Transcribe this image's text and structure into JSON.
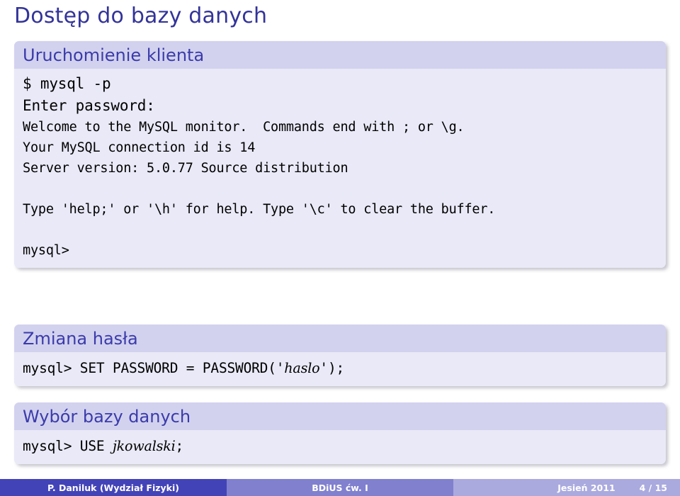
{
  "slide": {
    "title": "Dostęp do bazy danych",
    "blocks": [
      {
        "id": "client",
        "title": "Uruchomienie klienta",
        "lines": [
          "$ mysql -p",
          "Enter password:",
          "Welcome to the MySQL monitor.  Commands end with ; or \\g.",
          "Your MySQL connection id is 14",
          "Server version: 5.0.77 Source distribution",
          "",
          "Type 'help;' or '\\h' for help. Type '\\c' to clear the buffer.",
          "",
          "mysql>"
        ]
      },
      {
        "id": "password",
        "title": "Zmiana hasła",
        "command_prefix": "mysql> SET PASSWORD = PASSWORD('",
        "command_arg": "haslo",
        "command_suffix": "');"
      },
      {
        "id": "database",
        "title": "Wybór bazy danych",
        "command_prefix": "mysql> USE ",
        "command_arg": "jkowalski",
        "command_suffix": ";"
      }
    ]
  },
  "footer": {
    "author": "P. Daniluk  (Wydział Fizyki)",
    "subject": "BDiUS ćw. I",
    "date": "Jesień 2011",
    "page": "4 / 15"
  },
  "colors": {
    "title_text": "#33339a",
    "block_title_bg": "#d2d2ef",
    "block_title_text": "#3b3bab",
    "block_body_bg": "#e9e9f7",
    "footer_dark": "#4343b8",
    "footer_mid": "#8080cf",
    "footer_light": "#aaaadf",
    "page_bg": "#ffffff",
    "mono_text": "#000000"
  }
}
